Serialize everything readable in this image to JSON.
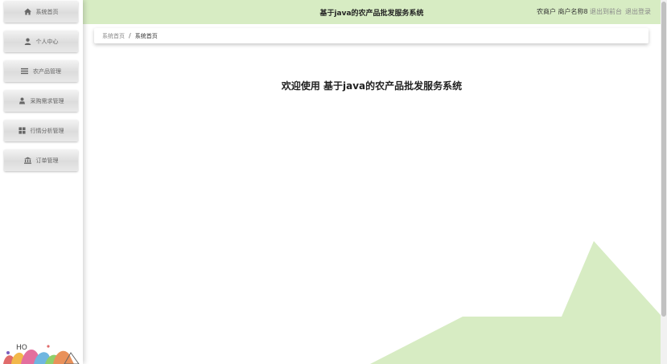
{
  "header": {
    "title": "基于java的农产品批发服务系统",
    "user": "农商户 商户名称8",
    "back_to_front": "退出到前台",
    "logout": "退出登录",
    "color": "#d7ecc3"
  },
  "sidebar": {
    "items": [
      {
        "label": "系统首页",
        "icon": "home-icon"
      },
      {
        "label": "个人中心",
        "icon": "user-icon"
      },
      {
        "label": "农产品管理",
        "icon": "list-icon"
      },
      {
        "label": "采购需求管理",
        "icon": "person-icon"
      },
      {
        "label": "行情分析管理",
        "icon": "grid-icon"
      },
      {
        "label": "订单管理",
        "icon": "bank-icon"
      }
    ]
  },
  "breadcrumb": {
    "home": "系统首页",
    "separator": "/",
    "current": "系统首页"
  },
  "main": {
    "welcome": "欢迎使用 基于java的农产品批发服务系统",
    "accent": "#d7ecc3"
  },
  "logo": {
    "text": "HO"
  }
}
